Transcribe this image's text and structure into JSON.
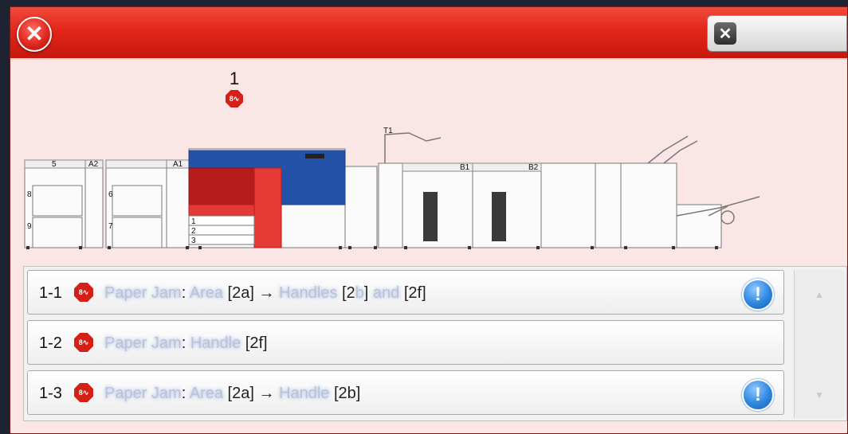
{
  "titlebar": {
    "alert_icon": "x-circle-icon",
    "close_icon": "close-x-icon"
  },
  "device": {
    "fault_location_number": "1",
    "fault_icon": "paper-jam-icon"
  },
  "machine_labels": {
    "tray5": "5",
    "a2": "A2",
    "a1": "A1",
    "tray8": "8",
    "tray9": "9",
    "tray6": "6",
    "tray7": "7",
    "tray1": "1",
    "tray2": "2",
    "tray3": "3",
    "t1": "T1",
    "b1": "B1",
    "b2": "B2"
  },
  "faults": [
    {
      "id": "1-1",
      "prefix": "Paper Jam",
      "sep": ": ",
      "parts": [
        {
          "t": "Area",
          "blur": true
        },
        {
          "t": " [2a] → ",
          "blur": false
        },
        {
          "t": "Handles",
          "blur": true
        },
        {
          "t": " [2",
          "blur": false
        },
        {
          "t": "b",
          "blur": true
        },
        {
          "t": "] ",
          "blur": false
        },
        {
          "t": "and",
          "blur": true
        },
        {
          "t": " [2f]",
          "blur": false
        }
      ],
      "has_info": true
    },
    {
      "id": "1-2",
      "prefix": "Paper Jam",
      "sep": ": ",
      "parts": [
        {
          "t": "Handle",
          "blur": true
        },
        {
          "t": " [2f]",
          "blur": false
        }
      ],
      "has_info": false
    },
    {
      "id": "1-3",
      "prefix": "Paper Jam",
      "sep": ": ",
      "parts": [
        {
          "t": "Area",
          "blur": true
        },
        {
          "t": " [2a] → ",
          "blur": false
        },
        {
          "t": "Handle",
          "blur": true
        },
        {
          "t": " [2b]",
          "blur": false
        }
      ],
      "has_info": true
    }
  ],
  "scroll": {
    "up_icon": "scroll-up-arrow-icon",
    "down_icon": "scroll-down-arrow-icon"
  }
}
